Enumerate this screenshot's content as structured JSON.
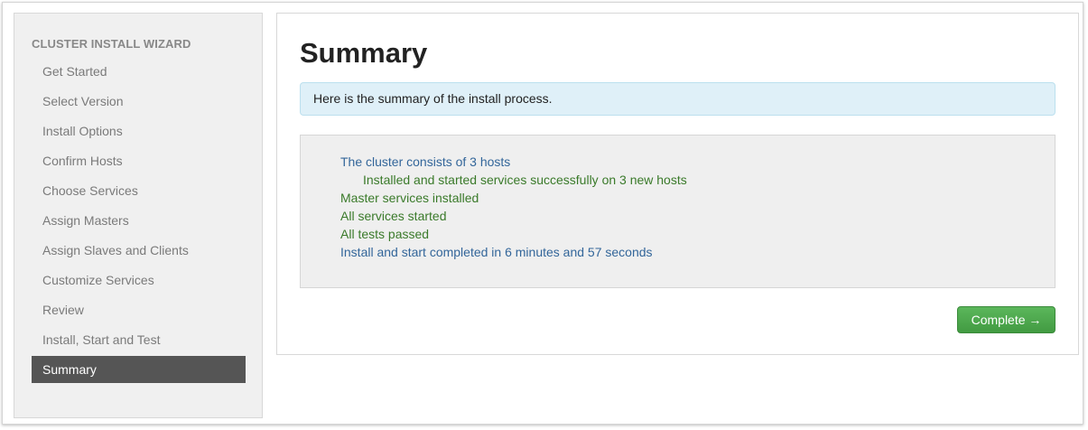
{
  "sidebar": {
    "title": "CLUSTER INSTALL WIZARD",
    "items": [
      {
        "label": "Get Started"
      },
      {
        "label": "Select Version"
      },
      {
        "label": "Install Options"
      },
      {
        "label": "Confirm Hosts"
      },
      {
        "label": "Choose Services"
      },
      {
        "label": "Assign Masters"
      },
      {
        "label": "Assign Slaves and Clients"
      },
      {
        "label": "Customize Services"
      },
      {
        "label": "Review"
      },
      {
        "label": "Install, Start and Test"
      },
      {
        "label": "Summary",
        "active": true
      }
    ]
  },
  "main": {
    "title": "Summary",
    "info_message": "Here is the summary of the install process.",
    "summary_lines": [
      {
        "text": "The cluster consists of 3 hosts",
        "color": "#33669a"
      },
      {
        "text": "Installed and started services successfully on 3 new hosts",
        "color": "#3a7a2a"
      },
      {
        "text": "Master services installed",
        "color": "#3a7a2a"
      },
      {
        "text": "All services started",
        "color": "#3a7a2a"
      },
      {
        "text": "All tests passed",
        "color": "#3a7a2a"
      },
      {
        "text": "Install and start completed in 6 minutes and 57 seconds",
        "color": "#33669a"
      }
    ],
    "complete_button": "Complete →"
  },
  "colors": {
    "active_nav_bg": "#555555",
    "info_bg": "#dff0f8",
    "success_button": "#5bb75b"
  }
}
